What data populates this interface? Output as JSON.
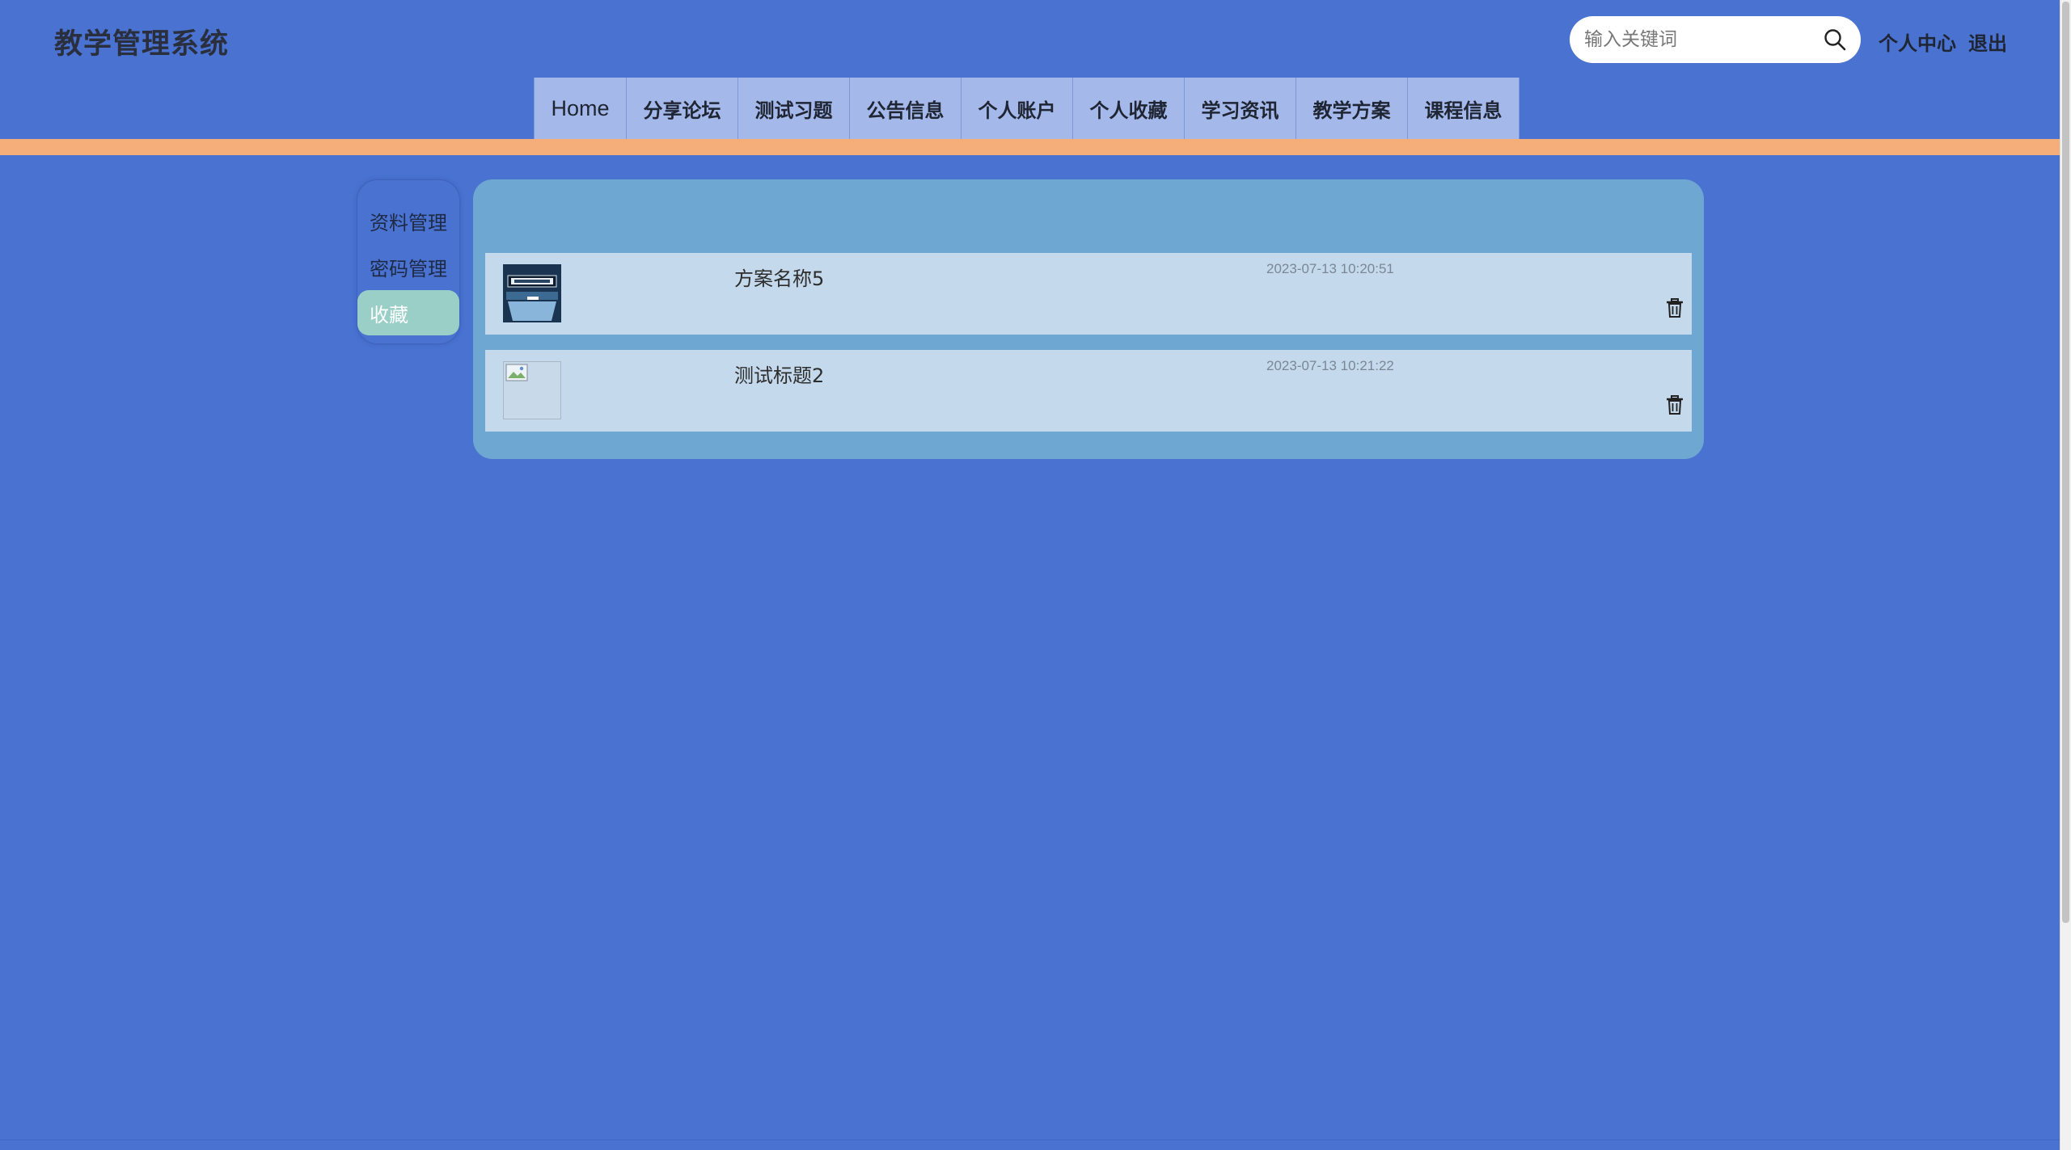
{
  "header": {
    "title": "教学管理系统",
    "search_placeholder": "输入关键词",
    "links": [
      "个人中心",
      "退出"
    ]
  },
  "nav": {
    "items": [
      "Home",
      "分享论坛",
      "测试习题",
      "公告信息",
      "个人账户",
      "个人收藏",
      "学习资讯",
      "教学方案",
      "课程信息"
    ]
  },
  "sidebar": {
    "items": [
      "资料管理",
      "密码管理",
      "收藏"
    ],
    "active": "收藏"
  },
  "favorites": [
    {
      "title": "方案名称5",
      "time": "2023-07-13 10:20:51",
      "thumb": "book-cover"
    },
    {
      "title": "测试标题2",
      "time": "2023-07-13 10:21:22",
      "thumb": "broken-image"
    }
  ],
  "colors": {
    "background": "#4a72d1",
    "nav_item": "#a4b8ea",
    "accent_bar": "#f5ad7a",
    "panel": "#6ea7d2",
    "card": "#c4d9eb",
    "sidebar_active": "#99cfc7"
  },
  "icons": {
    "search": "search-icon",
    "delete": "trash-icon"
  }
}
